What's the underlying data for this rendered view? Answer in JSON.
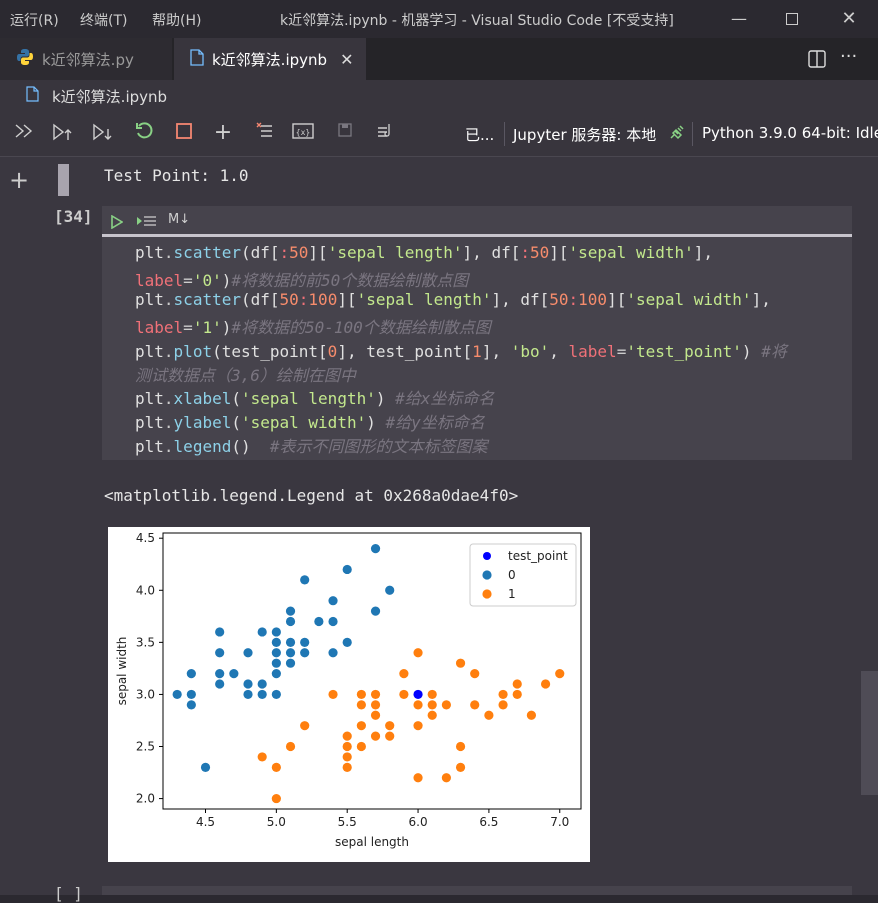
{
  "menu": [
    "运行(R)",
    "终端(T)",
    "帮助(H)"
  ],
  "window_title": "k近邻算法.ipynb - 机器学习 - Visual Studio Code [不受支持]",
  "tabs": [
    {
      "label": "k近邻算法.py",
      "icon": "python-icon",
      "active": false
    },
    {
      "label": "k近邻算法.ipynb",
      "icon": "notebook-file-icon",
      "active": true
    }
  ],
  "breadcrumb": "k近邻算法.ipynb",
  "toolbar": {
    "trusted": "已...",
    "jupyter_server": "Jupyter 服务器: 本地",
    "kernel": "Python 3.9.0 64-bit: Idle"
  },
  "prev_output": "Test Point: 1.0",
  "cell": {
    "exec_count": "[34]",
    "md_label": "M↓",
    "code_lines": [
      [
        [
          "plt",
          ""
        ],
        [
          ".",
          "par"
        ],
        [
          "scatter",
          "fn"
        ],
        [
          "(df[",
          ""
        ],
        [
          ":",
          "kw"
        ],
        [
          "50",
          "num"
        ],
        [
          "][",
          ""
        ],
        [
          "'sepal length'",
          "str"
        ],
        [
          "], df[",
          ""
        ],
        [
          ":",
          "kw"
        ],
        [
          "50",
          "num"
        ],
        [
          "][",
          ""
        ],
        [
          "'sepal width'",
          "str"
        ],
        [
          "],",
          ""
        ]
      ],
      [
        [
          "label",
          "kw"
        ],
        [
          "=",
          "par"
        ],
        [
          "'0'",
          "str"
        ],
        [
          ")",
          ""
        ],
        [
          "#将数据的前50个数据绘制散点图",
          "cm"
        ]
      ],
      [
        [
          "plt",
          ""
        ],
        [
          ".",
          "par"
        ],
        [
          "scatter",
          "fn"
        ],
        [
          "(df[",
          ""
        ],
        [
          "50",
          "num"
        ],
        [
          ":",
          "kw"
        ],
        [
          "100",
          "num"
        ],
        [
          "][",
          ""
        ],
        [
          "'sepal length'",
          "str"
        ],
        [
          "], df[",
          ""
        ],
        [
          "50",
          "num"
        ],
        [
          ":",
          "kw"
        ],
        [
          "100",
          "num"
        ],
        [
          "][",
          ""
        ],
        [
          "'sepal width'",
          "str"
        ],
        [
          "],",
          ""
        ]
      ],
      [
        [
          "label",
          "kw"
        ],
        [
          "=",
          "par"
        ],
        [
          "'1'",
          "str"
        ],
        [
          ")",
          ""
        ],
        [
          "#将数据的50-100个数据绘制散点图",
          "cm"
        ]
      ],
      [
        [
          "plt",
          ""
        ],
        [
          ".",
          "par"
        ],
        [
          "plot",
          "fn"
        ],
        [
          "(test_point[",
          ""
        ],
        [
          "0",
          "num"
        ],
        [
          "], test_point[",
          ""
        ],
        [
          "1",
          "num"
        ],
        [
          "], ",
          ""
        ],
        [
          "'bo'",
          "str"
        ],
        [
          ", ",
          ""
        ],
        [
          "label",
          "kw"
        ],
        [
          "=",
          "par"
        ],
        [
          "'test_point'",
          "str"
        ],
        [
          ") ",
          ""
        ],
        [
          "#将",
          "cm"
        ]
      ],
      [
        [
          "测试数据点（3,6）绘制在图中",
          "cm"
        ]
      ],
      [
        [
          "plt",
          ""
        ],
        [
          ".",
          "par"
        ],
        [
          "xlabel",
          "fn"
        ],
        [
          "(",
          ""
        ],
        [
          "'sepal length'",
          "str"
        ],
        [
          ") ",
          ""
        ],
        [
          "#给x坐标命名",
          "cm"
        ]
      ],
      [
        [
          "plt",
          ""
        ],
        [
          ".",
          "par"
        ],
        [
          "ylabel",
          "fn"
        ],
        [
          "(",
          ""
        ],
        [
          "'sepal width'",
          "str"
        ],
        [
          ") ",
          ""
        ],
        [
          "#给y坐标命名",
          "cm"
        ]
      ],
      [
        [
          "plt",
          ""
        ],
        [
          ".",
          "par"
        ],
        [
          "legend",
          "fn"
        ],
        [
          "()  ",
          ""
        ],
        [
          "#表示不同图形的文本标签图案",
          "cm"
        ]
      ]
    ],
    "output_text": "<matplotlib.legend.Legend at 0x268a0dae4f0>"
  },
  "next_cell_exec": "[ ]",
  "chart_data": {
    "type": "scatter",
    "xlabel": "sepal length",
    "ylabel": "sepal width",
    "xlim": [
      4.2,
      7.15
    ],
    "ylim": [
      1.9,
      4.55
    ],
    "xticks": [
      "4.5",
      "5.0",
      "5.5",
      "6.0",
      "6.5",
      "7.0"
    ],
    "yticks": [
      "2.0",
      "2.5",
      "3.0",
      "3.5",
      "4.0",
      "4.5"
    ],
    "legend_position": "top-right",
    "grid": false,
    "series": [
      {
        "name": "test_point",
        "color": "#0000ff",
        "marker": "dot",
        "points": [
          [
            6.0,
            3.0
          ]
        ]
      },
      {
        "name": "0",
        "color": "#1f77b4",
        "points": [
          [
            4.3,
            3.0
          ],
          [
            4.4,
            3.2
          ],
          [
            4.4,
            3.0
          ],
          [
            4.4,
            2.9
          ],
          [
            4.5,
            2.3
          ],
          [
            4.6,
            3.6
          ],
          [
            4.6,
            3.4
          ],
          [
            4.6,
            3.2
          ],
          [
            4.6,
            3.1
          ],
          [
            4.7,
            3.2
          ],
          [
            4.8,
            3.4
          ],
          [
            4.8,
            3.1
          ],
          [
            4.8,
            3.0
          ],
          [
            4.9,
            3.6
          ],
          [
            4.9,
            3.1
          ],
          [
            4.9,
            3.0
          ],
          [
            5.0,
            3.6
          ],
          [
            5.0,
            3.5
          ],
          [
            5.0,
            3.4
          ],
          [
            5.0,
            3.3
          ],
          [
            5.0,
            3.2
          ],
          [
            5.0,
            3.0
          ],
          [
            5.1,
            3.8
          ],
          [
            5.1,
            3.7
          ],
          [
            5.1,
            3.5
          ],
          [
            5.1,
            3.4
          ],
          [
            5.1,
            3.3
          ],
          [
            5.2,
            4.1
          ],
          [
            5.2,
            3.5
          ],
          [
            5.2,
            3.4
          ],
          [
            5.3,
            3.7
          ],
          [
            5.4,
            3.9
          ],
          [
            5.4,
            3.7
          ],
          [
            5.4,
            3.4
          ],
          [
            5.5,
            4.2
          ],
          [
            5.5,
            3.5
          ],
          [
            5.7,
            4.4
          ],
          [
            5.7,
            3.8
          ],
          [
            5.8,
            4.0
          ]
        ]
      },
      {
        "name": "1",
        "color": "#ff7f0e",
        "points": [
          [
            4.9,
            2.4
          ],
          [
            5.0,
            2.3
          ],
          [
            5.0,
            2.0
          ],
          [
            5.1,
            2.5
          ],
          [
            5.2,
            2.7
          ],
          [
            5.4,
            3.0
          ],
          [
            5.5,
            2.6
          ],
          [
            5.5,
            2.5
          ],
          [
            5.5,
            2.4
          ],
          [
            5.5,
            2.3
          ],
          [
            5.6,
            3.0
          ],
          [
            5.6,
            2.9
          ],
          [
            5.6,
            2.7
          ],
          [
            5.6,
            2.5
          ],
          [
            5.7,
            3.0
          ],
          [
            5.7,
            2.9
          ],
          [
            5.7,
            2.8
          ],
          [
            5.7,
            2.6
          ],
          [
            5.8,
            2.7
          ],
          [
            5.8,
            2.6
          ],
          [
            5.9,
            3.2
          ],
          [
            5.9,
            3.0
          ],
          [
            6.0,
            3.4
          ],
          [
            6.0,
            2.9
          ],
          [
            6.0,
            2.7
          ],
          [
            6.0,
            2.2
          ],
          [
            6.1,
            3.0
          ],
          [
            6.1,
            2.9
          ],
          [
            6.1,
            2.8
          ],
          [
            6.2,
            2.9
          ],
          [
            6.2,
            2.2
          ],
          [
            6.3,
            3.3
          ],
          [
            6.3,
            2.5
          ],
          [
            6.3,
            2.3
          ],
          [
            6.4,
            3.2
          ],
          [
            6.4,
            2.9
          ],
          [
            6.5,
            2.8
          ],
          [
            6.6,
            3.0
          ],
          [
            6.6,
            2.9
          ],
          [
            6.7,
            3.1
          ],
          [
            6.7,
            3.0
          ],
          [
            6.8,
            2.8
          ],
          [
            6.9,
            3.1
          ],
          [
            7.0,
            3.2
          ]
        ]
      }
    ]
  }
}
